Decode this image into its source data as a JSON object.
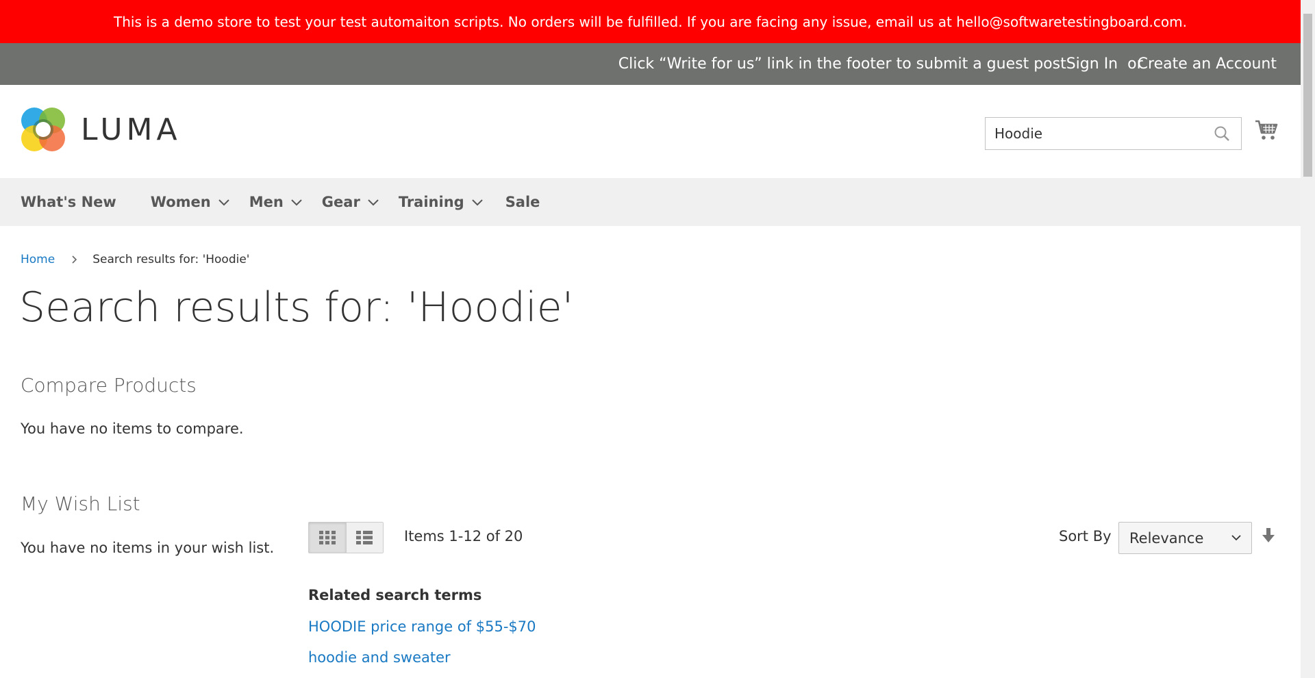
{
  "banner": {
    "text": "This is a demo store to test your test automaiton scripts. No orders will be fulfilled. If you are facing any issue, email us at hello@softwaretestingboard.com."
  },
  "panel": {
    "write_for_us": "Click “Write for us” link in the footer to submit a guest post",
    "sign_in": "Sign In",
    "or": "or",
    "create_account": "Create an Account"
  },
  "header": {
    "logo_text": "LUMA",
    "search_value": "Hoodie"
  },
  "nav": {
    "items": [
      {
        "label": "What's New"
      },
      {
        "label": "Women"
      },
      {
        "label": "Men"
      },
      {
        "label": "Gear"
      },
      {
        "label": "Training"
      },
      {
        "label": "Sale"
      }
    ]
  },
  "breadcrumb": {
    "home": "Home",
    "current": "Search results for: 'Hoodie'"
  },
  "page": {
    "title": "Search results for: 'Hoodie'"
  },
  "sidebar": {
    "compare_title": "Compare Products",
    "compare_empty": "You have no items to compare.",
    "wishlist_title": "My Wish List",
    "wishlist_empty": "You have no items in your wish list."
  },
  "toolbar": {
    "amount": "Items 1-12 of 20",
    "sort_label": "Sort By",
    "sort_value": "Relevance"
  },
  "related": {
    "title": "Related search terms",
    "terms": [
      "HOODIE price range of $55-$70",
      "hoodie and sweater"
    ]
  },
  "colors": {
    "banner_bg": "#ff0000",
    "panel_bg": "#6e716e",
    "nav_bg": "#f0f0f0",
    "link": "#1979c3"
  }
}
